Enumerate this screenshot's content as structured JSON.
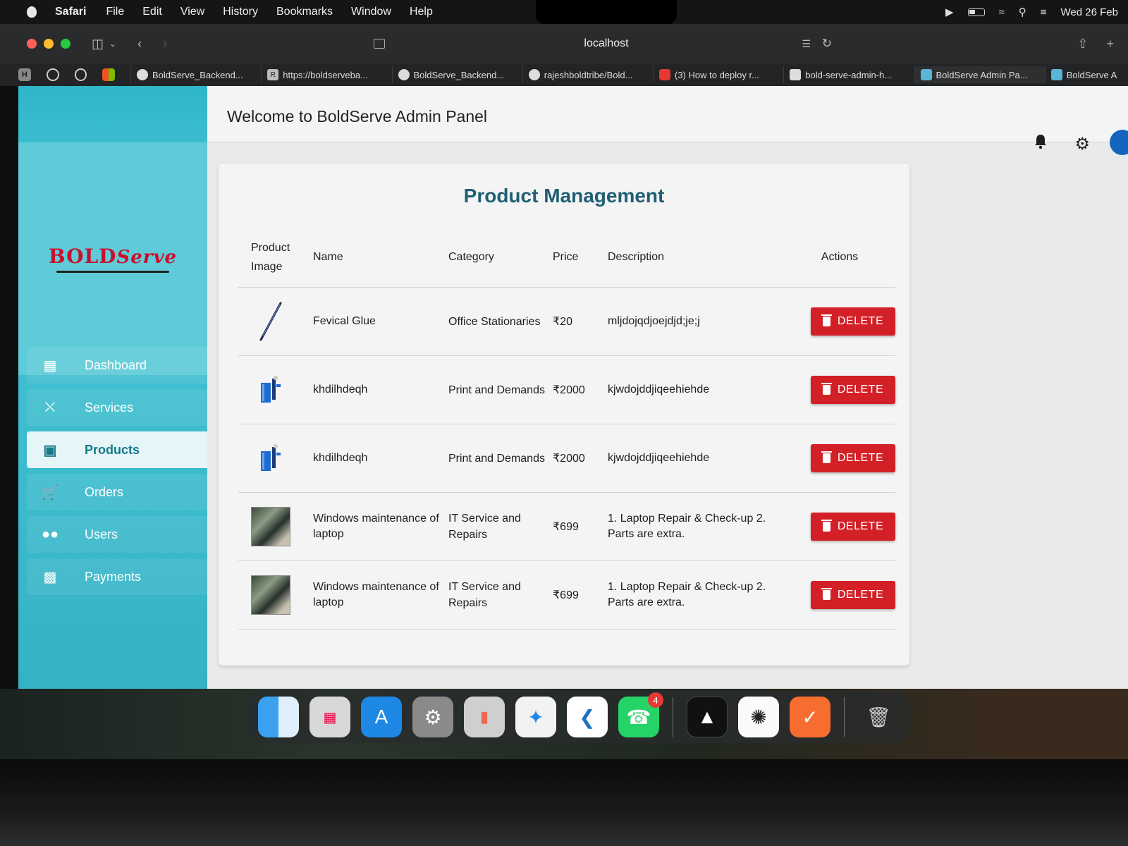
{
  "menubar": {
    "app_name": "Safari",
    "items": [
      "File",
      "Edit",
      "View",
      "History",
      "Bookmarks",
      "Window",
      "Help"
    ],
    "clock": "Wed 26 Feb"
  },
  "browser": {
    "url": "localhost",
    "tabs": [
      "BoldServe_Backend...",
      "https://boldserveba...",
      "BoldServe_Backend...",
      "rajeshboldtribe/Bold...",
      "(3) How to deploy r...",
      "bold-serve-admin-h...",
      "BoldServe Admin Pa...",
      "BoldServe A"
    ]
  },
  "brand": {
    "logo_bold": "BOLD",
    "logo_serve": "Serve",
    "accent": "#2fb6c9",
    "danger": "#d32027",
    "title_color": "#1f5f74"
  },
  "sidebar": {
    "items": [
      {
        "label": "Dashboard",
        "icon": "dashboard-icon"
      },
      {
        "label": "Services",
        "icon": "services-icon"
      },
      {
        "label": "Products",
        "icon": "archive-icon",
        "active": true
      },
      {
        "label": "Orders",
        "icon": "cart-icon"
      },
      {
        "label": "Users",
        "icon": "users-icon"
      },
      {
        "label": "Payments",
        "icon": "payments-icon"
      }
    ]
  },
  "header": {
    "title": "Welcome to BoldServe Admin Panel"
  },
  "products": {
    "title": "Product Management",
    "columns": {
      "image": "Product Image",
      "image_line1": "Product",
      "image_line2": "Image",
      "name": "Name",
      "category": "Category",
      "price": "Price",
      "description": "Description",
      "actions": "Actions"
    },
    "delete_label": "DELETE",
    "rows": [
      {
        "name": "Fevical Glue",
        "category": "Office Stationaries",
        "price": "₹20",
        "description": "mljdojqdjoejdjd;je;j",
        "image": "pen-image"
      },
      {
        "name": "khdilhdeqh",
        "category": "Print and Demands",
        "price": "₹2000",
        "description": "kjwdojddjiqeehiehde",
        "image": "printer-image"
      },
      {
        "name": "khdilhdeqh",
        "category": "Print and Demands",
        "price": "₹2000",
        "description": "kjwdojddjiqeehiehde",
        "image": "printer-image"
      },
      {
        "name": "Windows maintenance of laptop",
        "category": "IT Service and Repairs",
        "price": "₹699",
        "description": "1. Laptop Repair & Check-up 2. Parts are extra.",
        "image": "laptop-repair-photo"
      },
      {
        "name": "Windows maintenance of laptop",
        "category": "IT Service and Repairs",
        "price": "₹699",
        "description": "1. Laptop Repair & Check-up 2. Parts are extra.",
        "image": "laptop-repair-photo"
      }
    ]
  },
  "dock": {
    "apps": [
      "Finder",
      "Launchpad",
      "App Store",
      "System Settings",
      "iPhone Mirroring",
      "Safari",
      "Visual Studio Code",
      "WhatsApp",
      "Cursor",
      "ChatGPT",
      "Postman",
      "Trash"
    ],
    "whatsapp_badge": "4"
  }
}
